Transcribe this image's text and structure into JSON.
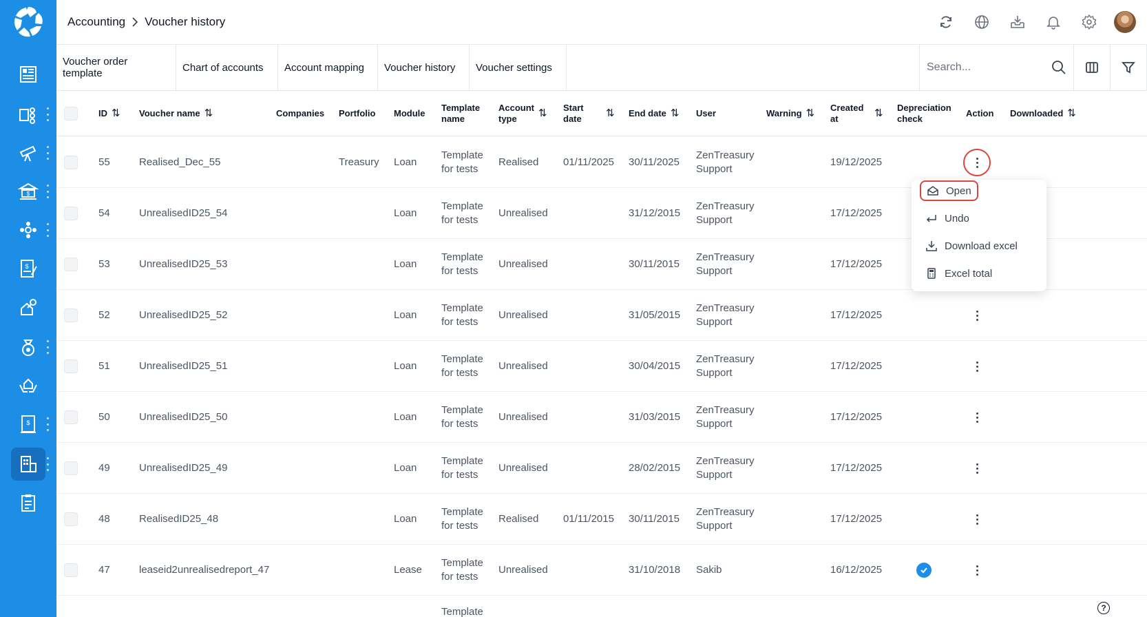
{
  "breadcrumb": {
    "parent": "Accounting",
    "current": "Voucher history"
  },
  "tabs": [
    {
      "label": "Voucher order template"
    },
    {
      "label": "Chart of accounts"
    },
    {
      "label": "Account mapping"
    },
    {
      "label": "Voucher history",
      "active": true
    },
    {
      "label": "Voucher settings"
    }
  ],
  "search": {
    "placeholder": "Search...",
    "value": ""
  },
  "columns": {
    "id": "ID",
    "voucher_name": "Voucher name",
    "companies": "Companies",
    "portfolio": "Portfolio",
    "module": "Module",
    "template_name": "Template name",
    "account_type": "Account type",
    "start_date": "Start date",
    "end_date": "End date",
    "user": "User",
    "warning": "Warning",
    "created_at": "Created at",
    "depreciation_check": "Depreciation check",
    "action": "Action",
    "downloaded": "Downloaded"
  },
  "rows": [
    {
      "id": "55",
      "name": "Realised_Dec_55",
      "portfolio": "Treasury",
      "module": "Loan",
      "template": "Template for tests",
      "account_type": "Realised",
      "start": "01/11/2025",
      "end": "30/11/2025",
      "user": "ZenTreasury Support",
      "created": "19/12/2025",
      "depreciation": false
    },
    {
      "id": "54",
      "name": "UnrealisedID25_54",
      "portfolio": "",
      "module": "Loan",
      "template": "Template for tests",
      "account_type": "Unrealised",
      "start": "",
      "end": "31/12/2015",
      "user": "ZenTreasury Support",
      "created": "17/12/2025",
      "depreciation": false
    },
    {
      "id": "53",
      "name": "UnrealisedID25_53",
      "portfolio": "",
      "module": "Loan",
      "template": "Template for tests",
      "account_type": "Unrealised",
      "start": "",
      "end": "30/11/2015",
      "user": "ZenTreasury Support",
      "created": "17/12/2025",
      "depreciation": false
    },
    {
      "id": "52",
      "name": "UnrealisedID25_52",
      "portfolio": "",
      "module": "Loan",
      "template": "Template for tests",
      "account_type": "Unrealised",
      "start": "",
      "end": "31/05/2015",
      "user": "ZenTreasury Support",
      "created": "17/12/2025",
      "depreciation": false
    },
    {
      "id": "51",
      "name": "UnrealisedID25_51",
      "portfolio": "",
      "module": "Loan",
      "template": "Template for tests",
      "account_type": "Unrealised",
      "start": "",
      "end": "30/04/2015",
      "user": "ZenTreasury Support",
      "created": "17/12/2025",
      "depreciation": false
    },
    {
      "id": "50",
      "name": "UnrealisedID25_50",
      "portfolio": "",
      "module": "Loan",
      "template": "Template for tests",
      "account_type": "Unrealised",
      "start": "",
      "end": "31/03/2015",
      "user": "ZenTreasury Support",
      "created": "17/12/2025",
      "depreciation": false
    },
    {
      "id": "49",
      "name": "UnrealisedID25_49",
      "portfolio": "",
      "module": "Loan",
      "template": "Template for tests",
      "account_type": "Unrealised",
      "start": "",
      "end": "28/02/2015",
      "user": "ZenTreasury Support",
      "created": "17/12/2025",
      "depreciation": false
    },
    {
      "id": "48",
      "name": "RealisedID25_48",
      "portfolio": "",
      "module": "Loan",
      "template": "Template for tests",
      "account_type": "Realised",
      "start": "01/11/2015",
      "end": "30/11/2015",
      "user": "ZenTreasury Support",
      "created": "17/12/2025",
      "depreciation": false
    },
    {
      "id": "47",
      "name": "leaseid2unrealisedreport_47",
      "portfolio": "",
      "module": "Lease",
      "template": "Template for tests",
      "account_type": "Unrealised",
      "start": "",
      "end": "31/10/2018",
      "user": "Sakib",
      "created": "16/12/2025",
      "depreciation": true
    }
  ],
  "partial_row": {
    "template": "Template"
  },
  "dropdown": {
    "items": [
      {
        "label": "Open",
        "icon": "envelope-open-icon"
      },
      {
        "label": "Undo",
        "icon": "undo-arrow-icon"
      },
      {
        "label": "Download excel",
        "icon": "download-icon"
      },
      {
        "label": "Excel total",
        "icon": "calculator-icon"
      }
    ]
  },
  "help": {
    "label": "?"
  },
  "colors": {
    "sidebar": "#1d8ee6",
    "sidebar_active": "#166fbf",
    "highlight": "#d9463b",
    "check": "#1d8ee6"
  }
}
